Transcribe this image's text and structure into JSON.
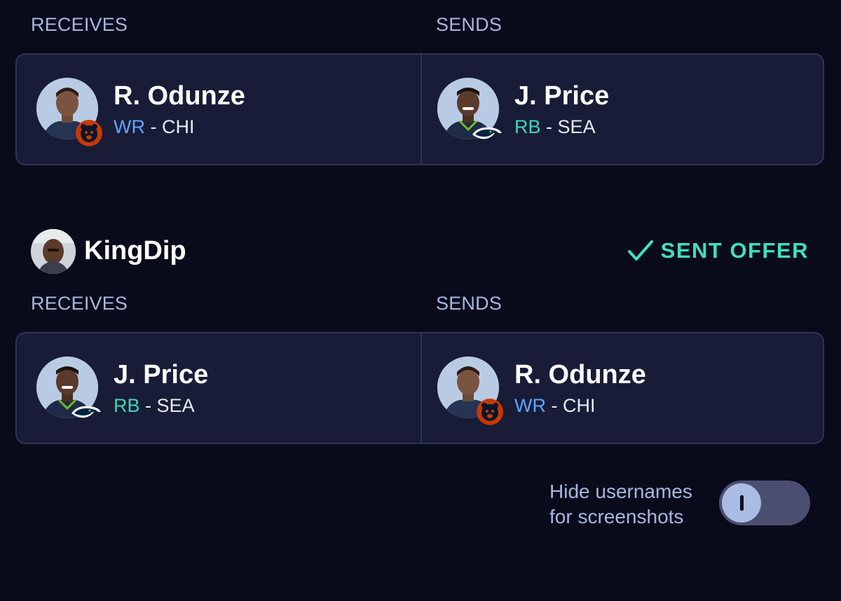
{
  "trade1": {
    "receives_label": "RECEIVES",
    "sends_label": "SENDS",
    "receives": {
      "name": "R. Odunze",
      "position": "WR",
      "team": "CHI",
      "team_logo": "bears-logo"
    },
    "sends": {
      "name": "J. Price",
      "position": "RB",
      "team": "SEA",
      "team_logo": "seahawks-logo"
    }
  },
  "trade2": {
    "username": "KingDip",
    "status": "SENT OFFER",
    "receives_label": "RECEIVES",
    "sends_label": "SENDS",
    "receives": {
      "name": "J. Price",
      "position": "RB",
      "team": "SEA",
      "team_logo": "seahawks-logo"
    },
    "sends": {
      "name": "R. Odunze",
      "position": "WR",
      "team": "CHI",
      "team_logo": "bears-logo"
    }
  },
  "settings": {
    "hide_usernames_line1": "Hide usernames",
    "hide_usernames_line2": "for screenshots",
    "hide_usernames_enabled": false
  },
  "sep": "-",
  "colors": {
    "background": "#090b1b",
    "card": "#181c36",
    "wr": "#5ea6ff",
    "rb": "#3fd6b4",
    "accent": "#3fe0bd"
  }
}
